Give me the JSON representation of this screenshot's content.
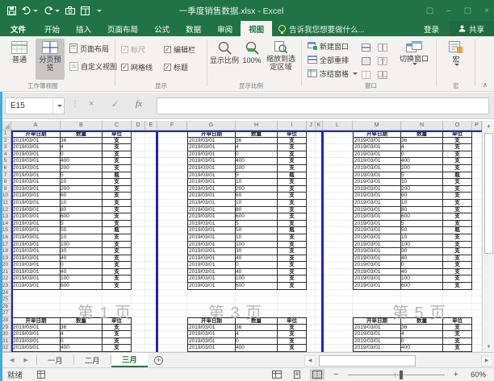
{
  "titlebar": {
    "title": "一季度销售数据.xlsx - Excel"
  },
  "menu": {
    "file": "文件",
    "tabs": [
      "开始",
      "插入",
      "页面布局",
      "公式",
      "数据",
      "审阅",
      "视图"
    ],
    "active_tab": "视图",
    "tell_me": "告诉我您想要做什么...",
    "sign_in": "登录",
    "share": "共享"
  },
  "ribbon": {
    "views_group": {
      "label": "工作簿视图",
      "normal": "普通",
      "page_break_preview": "分页预览",
      "page_layout": "页面布局",
      "custom_views": "自定义视图"
    },
    "show_group": {
      "label": "显示",
      "ruler": "标尺",
      "formula_bar": "编辑栏",
      "gridlines": "网格线",
      "headings": "标题"
    },
    "zoom_group": {
      "label": "显示比例",
      "zoom": "显示比例",
      "zoom_100": "100%",
      "zoom_to_selection": "缩放到选定区域"
    },
    "window_group": {
      "label": "窗口",
      "new_window": "新建窗口",
      "arrange_all": "全部重排",
      "freeze_panes": "冻结窗格",
      "switch_windows": "切换窗口"
    },
    "macros_group": {
      "label": "宏",
      "macros": "宏"
    }
  },
  "formula": {
    "name_box": "E15",
    "value": ""
  },
  "grid": {
    "col_letters": [
      "A",
      "B",
      "C",
      "D",
      "E",
      "F",
      "G",
      "H",
      "I",
      "J",
      "K",
      "L",
      "M",
      "N",
      "O",
      "P"
    ],
    "table_headers": [
      "开单日期",
      "数量",
      "单位"
    ],
    "date": "2019/03/01",
    "quantities": [
      36,
      4,
      0,
      400,
      200,
      5,
      10,
      200,
      60,
      10,
      80,
      600,
      5,
      50,
      10,
      100,
      30,
      40,
      0,
      40,
      100,
      600
    ],
    "units": [
      "支",
      "支",
      "支",
      "支",
      "支",
      "瓶",
      "支",
      "支",
      "支",
      "支",
      "支",
      "支",
      "支",
      "瓶",
      "支",
      "支",
      "支",
      "支",
      "支",
      "支",
      "支",
      "支"
    ],
    "quantities2": [
      36,
      4,
      0,
      400
    ],
    "units2": [
      "支",
      "支",
      "支",
      "支"
    ],
    "watermarks": [
      "第 1 页",
      "第 3 页",
      "第 5 页"
    ]
  },
  "sheet_tabs": {
    "items": [
      "一月",
      "二月",
      "三月"
    ],
    "active": "三月"
  },
  "status": {
    "mode": "就绪",
    "zoom_level": "60%"
  },
  "colors": {
    "brand_green": "#217346",
    "page_break_blue": "#2121cc"
  }
}
